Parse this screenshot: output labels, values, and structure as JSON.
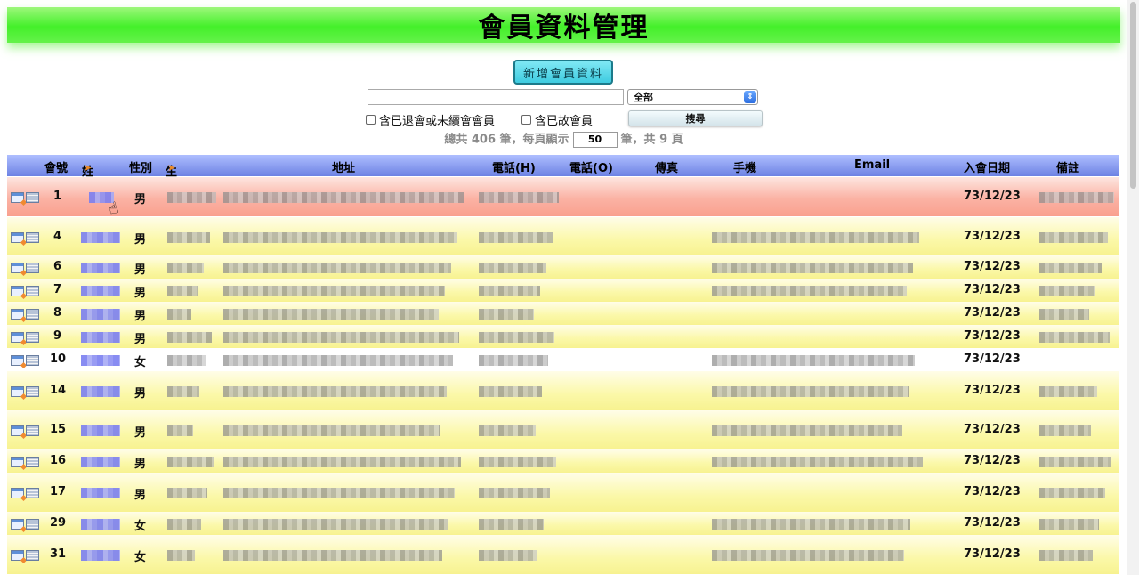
{
  "title": "會員資料管理",
  "add_button": "新增會員資料",
  "search": {
    "value": "",
    "filter_selected": "全部"
  },
  "checkboxes": [
    {
      "label": "含已退會或未續會會員",
      "checked": false
    },
    {
      "label": "含已故會員",
      "checked": false
    }
  ],
  "search_button": "搜尋",
  "paging": {
    "prefix": "總共 406 筆，每頁顯示",
    "per_page": "50",
    "suffix": "筆，共 9 頁"
  },
  "columns": {
    "id": "會號",
    "name": "姓名",
    "gender": "性別",
    "birthday": "生日",
    "address": "地址",
    "phone_h": "電話(H)",
    "phone_o": "電話(O)",
    "fax": "傳真",
    "mobile": "手機",
    "email": "Email",
    "join_date": "入會日期",
    "note": "備註"
  },
  "rows": [
    {
      "id": "1",
      "gender": "男",
      "join_date": "73/12/23"
    },
    {
      "id": "4",
      "gender": "男",
      "join_date": "73/12/23"
    },
    {
      "id": "6",
      "gender": "男",
      "join_date": "73/12/23"
    },
    {
      "id": "7",
      "gender": "男",
      "join_date": "73/12/23"
    },
    {
      "id": "8",
      "gender": "男",
      "join_date": "73/12/23"
    },
    {
      "id": "9",
      "gender": "男",
      "join_date": "73/12/23"
    },
    {
      "id": "10",
      "gender": "女",
      "join_date": "73/12/23"
    },
    {
      "id": "14",
      "gender": "男",
      "join_date": "73/12/23"
    },
    {
      "id": "15",
      "gender": "男",
      "join_date": "73/12/23"
    },
    {
      "id": "16",
      "gender": "男",
      "join_date": "73/12/23"
    },
    {
      "id": "17",
      "gender": "男",
      "join_date": "73/12/23"
    },
    {
      "id": "29",
      "gender": "女",
      "join_date": "73/12/23"
    },
    {
      "id": "31",
      "gender": "女",
      "join_date": "73/12/23"
    }
  ],
  "colors": {
    "header_green": "#44f02a",
    "header_blue": "#6d82e3",
    "row_yellow": "#fbf8a8",
    "row_highlight": "#fba898",
    "sort_orange": "#e8892b"
  }
}
